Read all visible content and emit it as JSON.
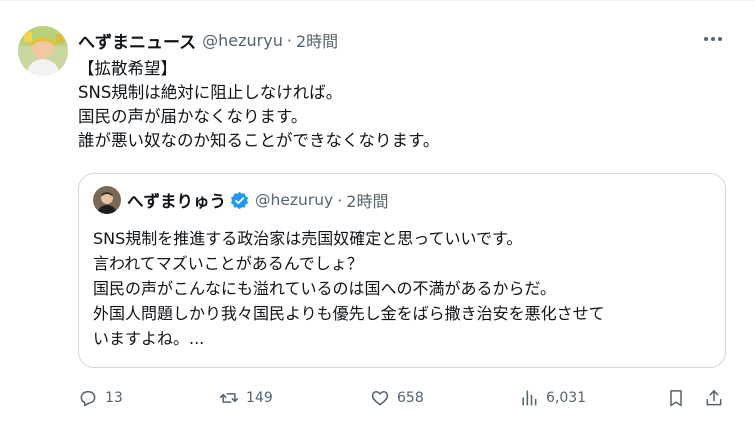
{
  "tweet": {
    "display_name": "へずまニュース",
    "handle": "@hezuryu",
    "separator": "·",
    "time": "2時間",
    "lines": [
      "【拡散希望】",
      "SNS規制は絶対に阻止しなければ。",
      "国民の声が届かなくなります。",
      "誰が悪い奴なのか知ることができなくなります。"
    ]
  },
  "quote": {
    "display_name": "へずまりゅう",
    "handle": "@hezuruy",
    "separator": "·",
    "time": "2時間",
    "lines": [
      "SNS規制を推進する政治家は売国奴確定と思っていいです。",
      "言われてマズいことがあるんでしょ？",
      "国民の声がこんなにも溢れているのは国への不満があるからだ。",
      "外国人問題しかり我々国民よりも優先し金をばら撒き治安を悪化させて",
      "いますよね。..."
    ]
  },
  "actions": {
    "replies": "13",
    "reposts": "149",
    "likes": "658",
    "views": "6,031"
  },
  "colors": {
    "text": "#0f1419",
    "muted": "#536471",
    "border": "#cfd9de",
    "verified": "#1d9bf0"
  },
  "icons": {
    "more": "more-icon",
    "verified": "verified-badge-icon",
    "reply": "reply-icon",
    "repost": "repost-icon",
    "like": "heart-icon",
    "views": "views-icon",
    "bookmark": "bookmark-icon",
    "share": "share-icon"
  }
}
